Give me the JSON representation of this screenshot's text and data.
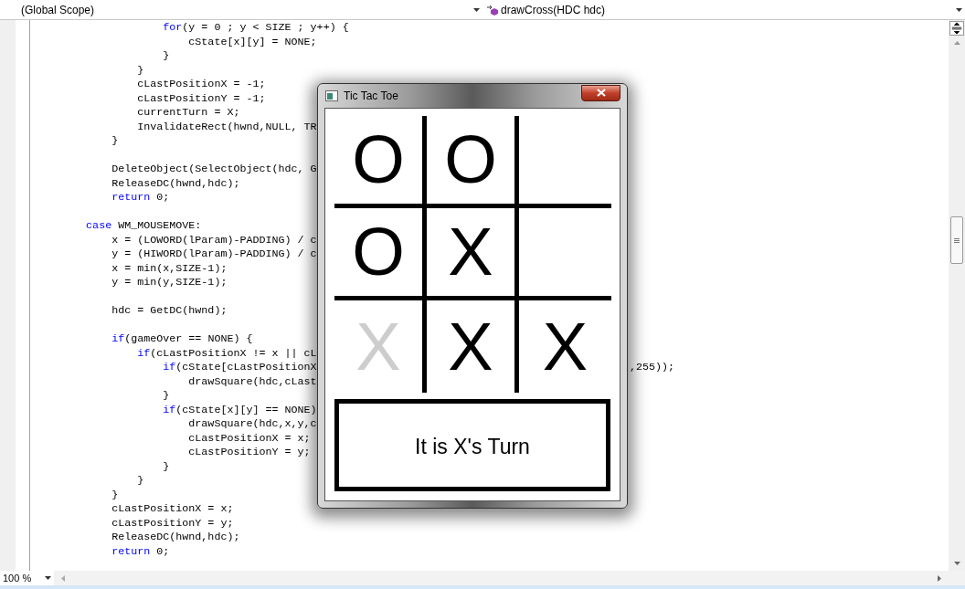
{
  "navigation_bar": {
    "scope": "(Global Scope)",
    "member": "drawCross(HDC hdc)"
  },
  "code_lines": [
    {
      "kind": "code",
      "segments": [
        {
          "kind": "keyword",
          "text": "                    for"
        },
        {
          "kind": "plain",
          "text": "(y = 0 ; y < SIZE ; y++) {"
        }
      ]
    },
    {
      "kind": "code",
      "segments": [
        {
          "kind": "plain",
          "text": "                        cState[x][y] = NONE;"
        }
      ]
    },
    {
      "kind": "code",
      "segments": [
        {
          "kind": "plain",
          "text": "                    }"
        }
      ]
    },
    {
      "kind": "code",
      "segments": [
        {
          "kind": "plain",
          "text": "                }"
        }
      ]
    },
    {
      "kind": "code",
      "segments": [
        {
          "kind": "plain",
          "text": "                cLastPositionX = -1;"
        }
      ]
    },
    {
      "kind": "code",
      "segments": [
        {
          "kind": "plain",
          "text": "                cLastPositionY = -1;"
        }
      ]
    },
    {
      "kind": "code",
      "segments": [
        {
          "kind": "plain",
          "text": "                currentTurn = X;"
        }
      ]
    },
    {
      "kind": "code",
      "segments": [
        {
          "kind": "plain",
          "text": "                InvalidateRect(hwnd,NULL, TR"
        }
      ]
    },
    {
      "kind": "code",
      "segments": [
        {
          "kind": "plain",
          "text": "            }"
        }
      ]
    },
    {
      "kind": "blank"
    },
    {
      "kind": "code",
      "segments": [
        {
          "kind": "plain",
          "text": "            DeleteObject(SelectObject(hdc, G"
        }
      ]
    },
    {
      "kind": "code",
      "segments": [
        {
          "kind": "plain",
          "text": "            ReleaseDC(hwnd,hdc);"
        }
      ]
    },
    {
      "kind": "code",
      "segments": [
        {
          "kind": "keyword",
          "text": "            return"
        },
        {
          "kind": "plain",
          "text": " 0;"
        }
      ]
    },
    {
      "kind": "blank"
    },
    {
      "kind": "code",
      "segments": [
        {
          "kind": "keyword",
          "text": "        case"
        },
        {
          "kind": "plain",
          "text": " WM_MOUSEMOVE:"
        }
      ]
    },
    {
      "kind": "code",
      "segments": [
        {
          "kind": "plain",
          "text": "            x = (LOWORD(lParam)-PADDING) / c"
        }
      ]
    },
    {
      "kind": "code",
      "segments": [
        {
          "kind": "plain",
          "text": "            y = (HIWORD(lParam)-PADDING) / c"
        }
      ]
    },
    {
      "kind": "code",
      "segments": [
        {
          "kind": "plain",
          "text": "            x = min(x,SIZE-1);"
        }
      ]
    },
    {
      "kind": "code",
      "segments": [
        {
          "kind": "plain",
          "text": "            y = min(y,SIZE-1);"
        }
      ]
    },
    {
      "kind": "blank"
    },
    {
      "kind": "code",
      "segments": [
        {
          "kind": "plain",
          "text": "            hdc = GetDC(hwnd);"
        }
      ]
    },
    {
      "kind": "blank"
    },
    {
      "kind": "code",
      "segments": [
        {
          "kind": "keyword",
          "text": "            if"
        },
        {
          "kind": "plain",
          "text": "(gameOver == NONE) {"
        }
      ]
    },
    {
      "kind": "code",
      "segments": [
        {
          "kind": "keyword",
          "text": "                if"
        },
        {
          "kind": "plain",
          "text": "(cLastPositionX != x || cL"
        }
      ]
    },
    {
      "kind": "code",
      "segments": [
        {
          "kind": "keyword",
          "text": "                    if"
        },
        {
          "kind": "plain",
          "text": "(cState[cLastPositionX"
        }
      ],
      "tail": ",255));"
    },
    {
      "kind": "code",
      "segments": [
        {
          "kind": "plain",
          "text": "                        drawSquare(hdc,cLast"
        }
      ]
    },
    {
      "kind": "code",
      "segments": [
        {
          "kind": "plain",
          "text": "                    }"
        }
      ]
    },
    {
      "kind": "code",
      "segments": [
        {
          "kind": "keyword",
          "text": "                    if"
        },
        {
          "kind": "plain",
          "text": "(cState[x][y] == NONE)"
        }
      ]
    },
    {
      "kind": "code",
      "segments": [
        {
          "kind": "plain",
          "text": "                        drawSquare(hdc,x,y,c"
        }
      ]
    },
    {
      "kind": "code",
      "segments": [
        {
          "kind": "plain",
          "text": "                        cLastPositionX = x;"
        }
      ]
    },
    {
      "kind": "code",
      "segments": [
        {
          "kind": "plain",
          "text": "                        cLastPositionY = y;"
        }
      ]
    },
    {
      "kind": "code",
      "segments": [
        {
          "kind": "plain",
          "text": "                    }"
        }
      ]
    },
    {
      "kind": "code",
      "segments": [
        {
          "kind": "plain",
          "text": "                }"
        }
      ]
    },
    {
      "kind": "code",
      "segments": [
        {
          "kind": "plain",
          "text": "            }"
        }
      ]
    },
    {
      "kind": "code",
      "segments": [
        {
          "kind": "plain",
          "text": "            cLastPositionX = x;"
        }
      ]
    },
    {
      "kind": "code",
      "segments": [
        {
          "kind": "plain",
          "text": "            cLastPositionY = y;"
        }
      ]
    },
    {
      "kind": "code",
      "segments": [
        {
          "kind": "plain",
          "text": "            ReleaseDC(hwnd,hdc);"
        }
      ]
    },
    {
      "kind": "code",
      "segments": [
        {
          "kind": "keyword",
          "text": "            return"
        },
        {
          "kind": "plain",
          "text": " 0;"
        }
      ]
    }
  ],
  "game_window": {
    "title": "Tic Tac Toe",
    "cells": [
      {
        "mark": "O",
        "preview": false
      },
      {
        "mark": "O",
        "preview": false
      },
      {},
      {
        "mark": "O",
        "preview": false
      },
      {
        "mark": "X",
        "preview": false
      },
      {},
      {
        "mark": "X",
        "preview": true
      },
      {
        "mark": "X",
        "preview": false
      },
      {
        "mark": "X",
        "preview": false
      }
    ],
    "status": "It is X's Turn"
  },
  "zoom": "100 %"
}
